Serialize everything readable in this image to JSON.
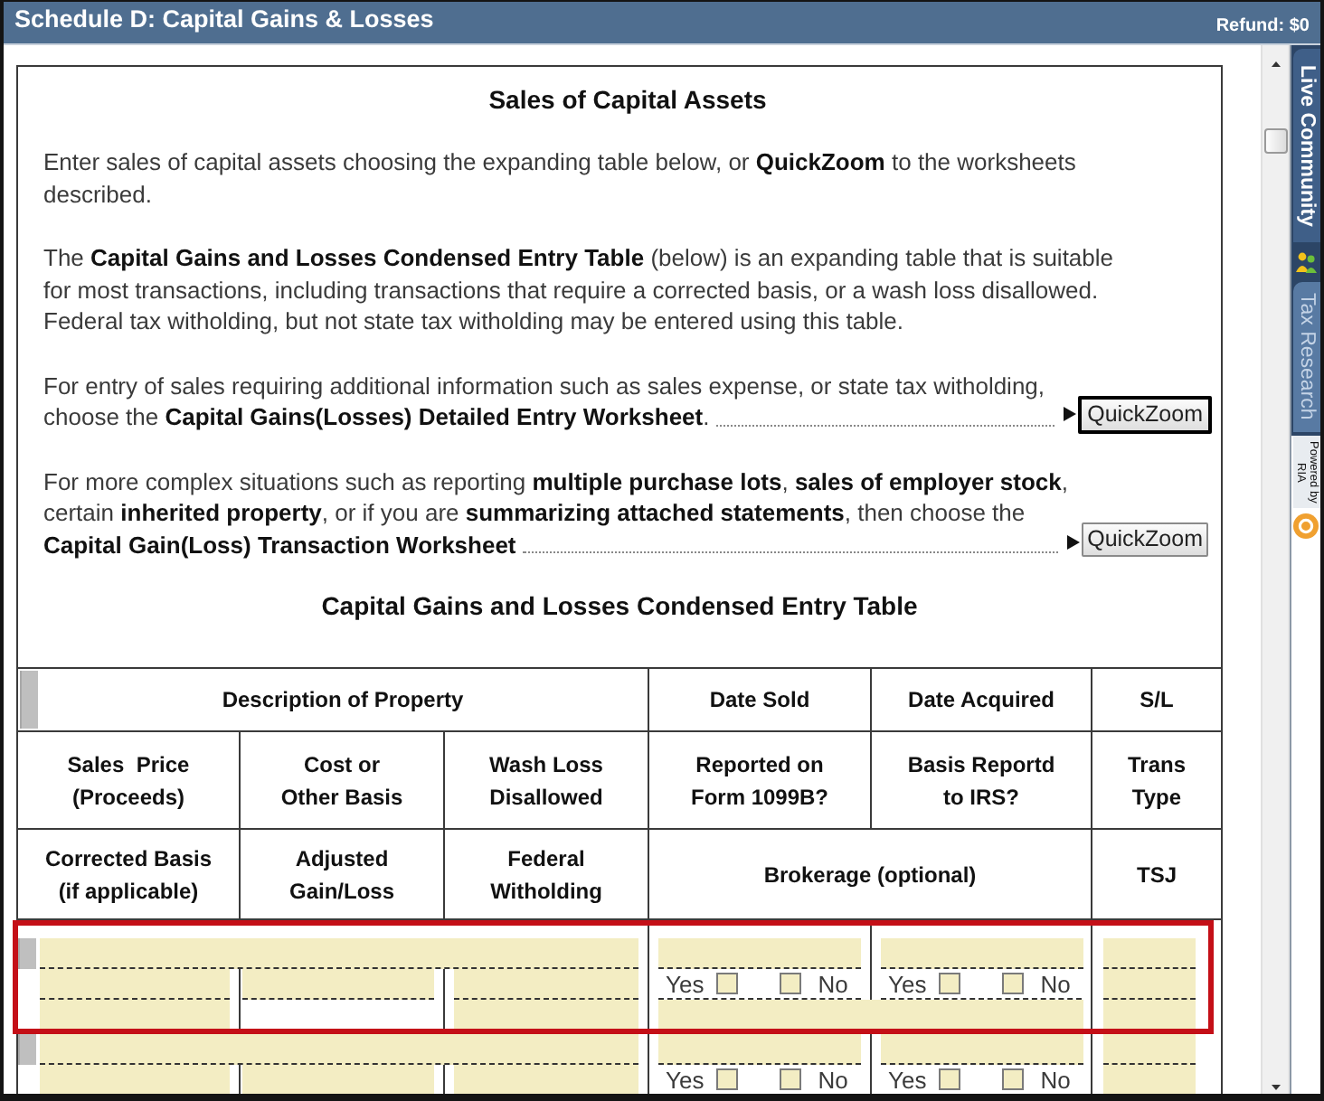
{
  "window": {
    "title": "Schedule D: Capital Gains & Losses",
    "refund": "Refund: $0"
  },
  "intro": {
    "heading": "Sales of Capital Assets",
    "sections": [
      {
        "kind": "text",
        "text": "Enter sales of capital assets choosing the expanding table below, or **QuickZoom** to the worksheets described."
      },
      {
        "kind": "text",
        "text": "The **Capital Gains and Losses Condensed Entry Table** (below) is an expanding table that is suitable for most transactions, including transactions that require a corrected basis, or a wash loss disallowed. Federal tax witholding, but not state tax witholding may be entered using this table."
      },
      {
        "kind": "quickzoom",
        "text": "For entry of sales requiring additional information such as sales expense, or state tax witholding,",
        "entry": "choose the **Capital Gains(Losses) Detailed Entry Worksheet**.",
        "button": "QuickZoom",
        "focused": true
      },
      {
        "kind": "quickzoom",
        "text": "For more complex situations such as reporting **multiple purchase lots**, **sales of employer stock**, certain **inherited property**, or if you are **summarizing attached statements**, then choose the",
        "entry": "**Capital Gain(Loss) Transaction Worksheet**",
        "button": "QuickZoom",
        "focused": false
      }
    ]
  },
  "table": {
    "title": "Capital Gains and Losses Condensed Entry Table",
    "header_rows": [
      [
        "Description of Property",
        "Date Sold",
        "Date Acquired",
        "S/L"
      ],
      [
        "Sales  Price\n(Proceeds)",
        "Cost or\nOther Basis",
        "Wash Loss\nDisallowed",
        "Reported on\nForm 1099B?",
        "Basis Reportd\nto IRS?",
        "Trans\nType"
      ],
      [
        "Corrected Basis\n(if applicable)",
        "Adjusted\nGain/Loss",
        "Federal\nWitholding",
        "Brokerage (optional)",
        "TSJ"
      ]
    ],
    "rows": [
      {
        "highlighted": true,
        "choices": [
          {
            "options": [
              {
                "label": "Yes",
                "checked": false
              },
              {
                "label": "No",
                "checked": false
              }
            ]
          },
          {
            "options": [
              {
                "label": "Yes",
                "checked": false
              },
              {
                "label": "No",
                "checked": false
              }
            ]
          }
        ]
      },
      {
        "highlighted": false,
        "choices": [
          {
            "options": [
              {
                "label": "Yes",
                "checked": false
              },
              {
                "label": "No",
                "checked": false
              }
            ]
          },
          {
            "options": [
              {
                "label": "Yes",
                "checked": false
              },
              {
                "label": "No",
                "checked": false
              }
            ]
          }
        ]
      }
    ]
  },
  "side_panel": {
    "tabs": [
      {
        "label": "Live Community",
        "selected": true
      },
      {
        "label": "Tax Research",
        "selected": false
      }
    ],
    "credit": "Powered by\nRIA"
  }
}
